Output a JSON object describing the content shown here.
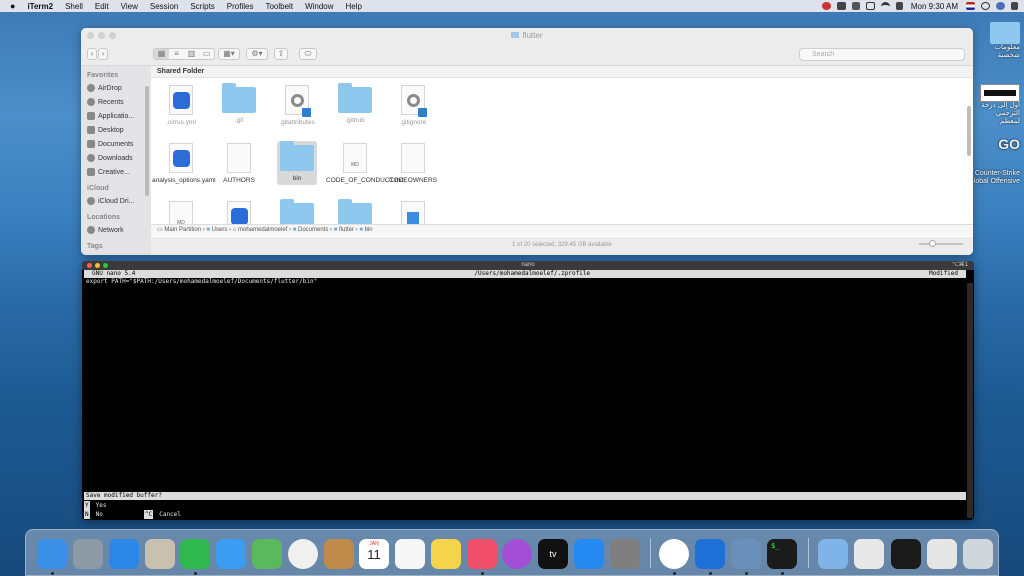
{
  "menubar": {
    "app": "iTerm2",
    "items": [
      "Shell",
      "Edit",
      "View",
      "Session",
      "Scripts",
      "Profiles",
      "Toolbelt",
      "Window",
      "Help"
    ],
    "clock": "Mon 9:30 AM"
  },
  "desktop": {
    "item1": "معلومات شخصية",
    "item2": "أول إلى درجة الترجمي لمعظم",
    "item3_logo": "GO",
    "item3": "Counter-Strike Global Offensive"
  },
  "finder": {
    "title": "flutter",
    "search_placeholder": "Search",
    "content_header": "Shared Folder",
    "sidebar": {
      "favorites_header": "Favorites",
      "favorites": [
        "AirDrop",
        "Recents",
        "Applicatio...",
        "Desktop",
        "Documents",
        "Downloads",
        "Creative..."
      ],
      "icloud_header": "iCloud",
      "icloud": [
        "iCloud Dri..."
      ],
      "locations_header": "Locations",
      "locations": [
        "Network"
      ],
      "tags_header": "Tags"
    },
    "files": [
      {
        "name": ".cirrus.yml",
        "kind": "xcode",
        "dim": true
      },
      {
        "name": ".git",
        "kind": "folder",
        "dim": true
      },
      {
        "name": ".gitattributes",
        "kind": "gear",
        "dim": true
      },
      {
        "name": ".github",
        "kind": "folder",
        "dim": true
      },
      {
        "name": ".gitignore",
        "kind": "gear",
        "dim": true
      },
      {
        "name": "analysis_options.yaml",
        "kind": "xcode",
        "dim": false
      },
      {
        "name": "AUTHORS",
        "kind": "doc",
        "dim": false
      },
      {
        "name": "bin",
        "kind": "folder",
        "dim": false
      },
      {
        "name": "CODE_OF_CONDUCT.md",
        "kind": "md",
        "dim": false
      },
      {
        "name": "CODEOWNERS",
        "kind": "doc",
        "dim": false
      },
      {
        "name": "",
        "kind": "md",
        "dim": false
      },
      {
        "name": "",
        "kind": "xcode",
        "dim": false
      },
      {
        "name": "",
        "kind": "folder",
        "dim": false
      },
      {
        "name": "",
        "kind": "folder",
        "dim": false
      },
      {
        "name": "",
        "kind": "win",
        "dim": false
      }
    ],
    "md_tag": "MD",
    "path": [
      "Main Partition",
      "Users",
      "mohamedalmoelef",
      "Documents",
      "flutter",
      "bin"
    ],
    "status": "1 of 20 selected, 329.45 GB available"
  },
  "iterm": {
    "title": "nano",
    "shortcut": "⌥⌘1",
    "nano_version": "GNU nano 5.4",
    "file_path": "/Users/mohamedalmoelef/.zprofile",
    "modified": "Modified",
    "line1": "export PATH=\"$PATH:/Users/mohamedalmoelef/Documents/flutter/bin\"",
    "prompt": "Save modified buffer?",
    "opt_yes_key": "Y",
    "opt_yes": "Yes",
    "opt_no_key": "N",
    "opt_no": "No",
    "opt_cancel_key": "^C",
    "opt_cancel": "Cancel"
  },
  "dock": {
    "calendar_month": "JAN",
    "calendar_day": "11",
    "tv_label": "tv",
    "terminal_prompt": "$_",
    "icons": [
      "finder-icon",
      "launchpad-icon",
      "safari-icon",
      "mail-stamp-icon",
      "facetime-icon",
      "messages-icon",
      "maps-icon",
      "photos-icon",
      "contacts-icon",
      "calendar-icon",
      "reminders-icon",
      "notes-icon",
      "music-icon",
      "podcasts-icon",
      "apple-tv-icon",
      "app-store-icon",
      "system-preferences-icon",
      "chrome-icon",
      "xcode-icon",
      "preview-icon",
      "iterm-icon",
      "downloads-stack-icon",
      "document-stack-icon",
      "screenshot-stack-icon",
      "screenshot-stack-icon-2",
      "trash-icon"
    ],
    "colors": [
      "#3a8fe6",
      "#8d9aa6",
      "#2b87e8",
      "#c9c1b0",
      "#2fb84d",
      "#3b9cf2",
      "#5bb85c",
      "#f0f0f0",
      "#c08a4a",
      "#ffffff",
      "#f7f7f7",
      "#f3d44a",
      "#f14e6a",
      "#a24fd6",
      "#111111",
      "#2489f0",
      "#7f7f7f",
      "#ffffff",
      "#1f6fd8",
      "#6a8fb8",
      "#1b1b1b",
      "#7fb4e8",
      "#e8e8e8",
      "#1a1a1a",
      "#e6e6e6",
      "#cfd6dc"
    ]
  }
}
